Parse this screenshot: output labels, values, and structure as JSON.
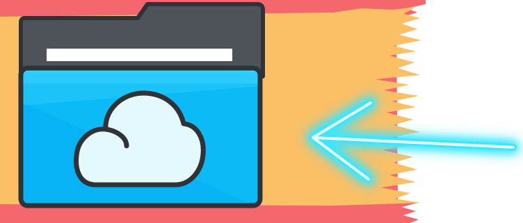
{
  "illustration": {
    "subject": "cloud-folder-with-arrow",
    "icons": [
      "cloud-folder-icon",
      "cloud-icon",
      "arrow-left-icon"
    ],
    "colors": {
      "paint_stripe_red": "#f4676f",
      "paint_stripe_orange": "#fbbf66",
      "folder_tab": "#4d5359",
      "folder_outline": "#2f3338",
      "folder_front": "#07b3f5",
      "folder_front_light": "#3cd0fb",
      "label_strip": "#ffffff",
      "cloud_fill": "#e4f9fb",
      "arrow_glow": "#3de6ff",
      "arrow_core": "#e9fdff"
    }
  }
}
